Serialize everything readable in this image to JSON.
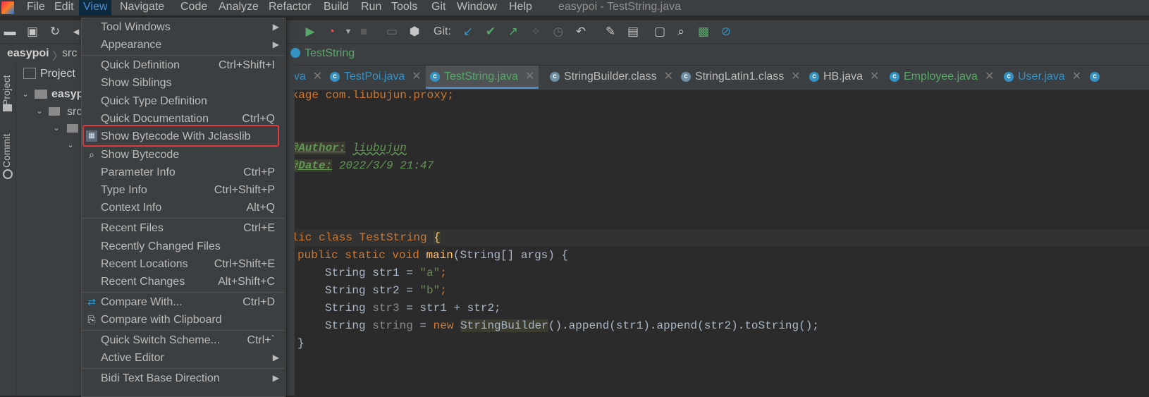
{
  "menubar": {
    "items": [
      "File",
      "Edit",
      "View",
      "Navigate",
      "Code",
      "Analyze",
      "Refactor",
      "Build",
      "Run",
      "Tools",
      "Git",
      "Window",
      "Help"
    ],
    "title": "easypoi - TestString.java"
  },
  "toolbar": {
    "git_label": "Git:"
  },
  "navbar": {
    "project": "easypoi",
    "src": "src",
    "file": "TestString"
  },
  "leftstrip": {
    "project_tab": "Project",
    "commit_tab": "Commit"
  },
  "project_panel": {
    "header": "Project",
    "root": "easyp",
    "src": "src"
  },
  "tabs": [
    {
      "label": ".java"
    },
    {
      "label": "TestPoi.java"
    },
    {
      "label": "TestString.java"
    },
    {
      "label": "StringBuilder.class"
    },
    {
      "label": "StringLatin1.class"
    },
    {
      "label": "HB.java"
    },
    {
      "label": "Employee.java"
    },
    {
      "label": "User.java"
    }
  ],
  "code": {
    "l1": "ckage com.liubujun.proxy;",
    "l3": "*",
    "author_tag": "@Author:",
    "author": "liubujun",
    "date_tag": "@Date:",
    "date": "2022/3/9 21:47",
    "l6": "/",
    "l9_a": "blic class TestString ",
    "l9_b": "{",
    "l10_kw": "public static void ",
    "l10_fn": "main",
    "l10_rest": "(String[] args) {",
    "l11_a": "String str1 = ",
    "l11_s": "\"a\"",
    "l12_a": "String str2 = ",
    "l12_s": "\"b\"",
    "l13_a": "String ",
    "l13_v": "str3",
    "l13_b": " = str1 + str2;",
    "l14_a": "String ",
    "l14_v": "string",
    "l14_b": " = ",
    "l14_new": "new ",
    "l14_sb": "StringBuilder",
    "l14_c": "().append(str1).append(str2).toString();",
    "l15": "}"
  },
  "dropdown": {
    "items": [
      {
        "label": "Tool Windows",
        "shortcut": "",
        "submenu": true
      },
      {
        "label": "Appearance",
        "shortcut": "",
        "submenu": true
      },
      {
        "label": "Quick Definition",
        "shortcut": "Ctrl+Shift+I"
      },
      {
        "label": "Show Siblings",
        "shortcut": ""
      },
      {
        "label": "Quick Type Definition",
        "shortcut": ""
      },
      {
        "label": "Quick Documentation",
        "shortcut": "Ctrl+Q"
      },
      {
        "label": "Show Bytecode With Jclasslib",
        "shortcut": "",
        "icon": "jclasslib-icon"
      },
      {
        "label": "Show Bytecode",
        "shortcut": "",
        "icon": "bytecode-icon"
      },
      {
        "label": "Parameter Info",
        "shortcut": "Ctrl+P"
      },
      {
        "label": "Type Info",
        "shortcut": "Ctrl+Shift+P"
      },
      {
        "label": "Context Info",
        "shortcut": "Alt+Q"
      },
      {
        "label": "Recent Files",
        "shortcut": "Ctrl+E"
      },
      {
        "label": "Recently Changed Files",
        "shortcut": ""
      },
      {
        "label": "Recent Locations",
        "shortcut": "Ctrl+Shift+E"
      },
      {
        "label": "Recent Changes",
        "shortcut": "Alt+Shift+C"
      },
      {
        "label": "Compare With...",
        "shortcut": "Ctrl+D",
        "icon": "compare-icon"
      },
      {
        "label": "Compare with Clipboard",
        "shortcut": "",
        "icon": "clipboard-compare-icon"
      },
      {
        "label": "Quick Switch Scheme...",
        "shortcut": "Ctrl+`"
      },
      {
        "label": "Active Editor",
        "shortcut": "",
        "submenu": true
      },
      {
        "label": "Bidi Text Base Direction",
        "shortcut": "",
        "submenu": true
      }
    ]
  },
  "colors": {
    "menu_bg": "#3c3f41",
    "editor_bg": "#2b2b2b",
    "highlight_box": "#e23a3a",
    "accent": "#4a88c7"
  }
}
